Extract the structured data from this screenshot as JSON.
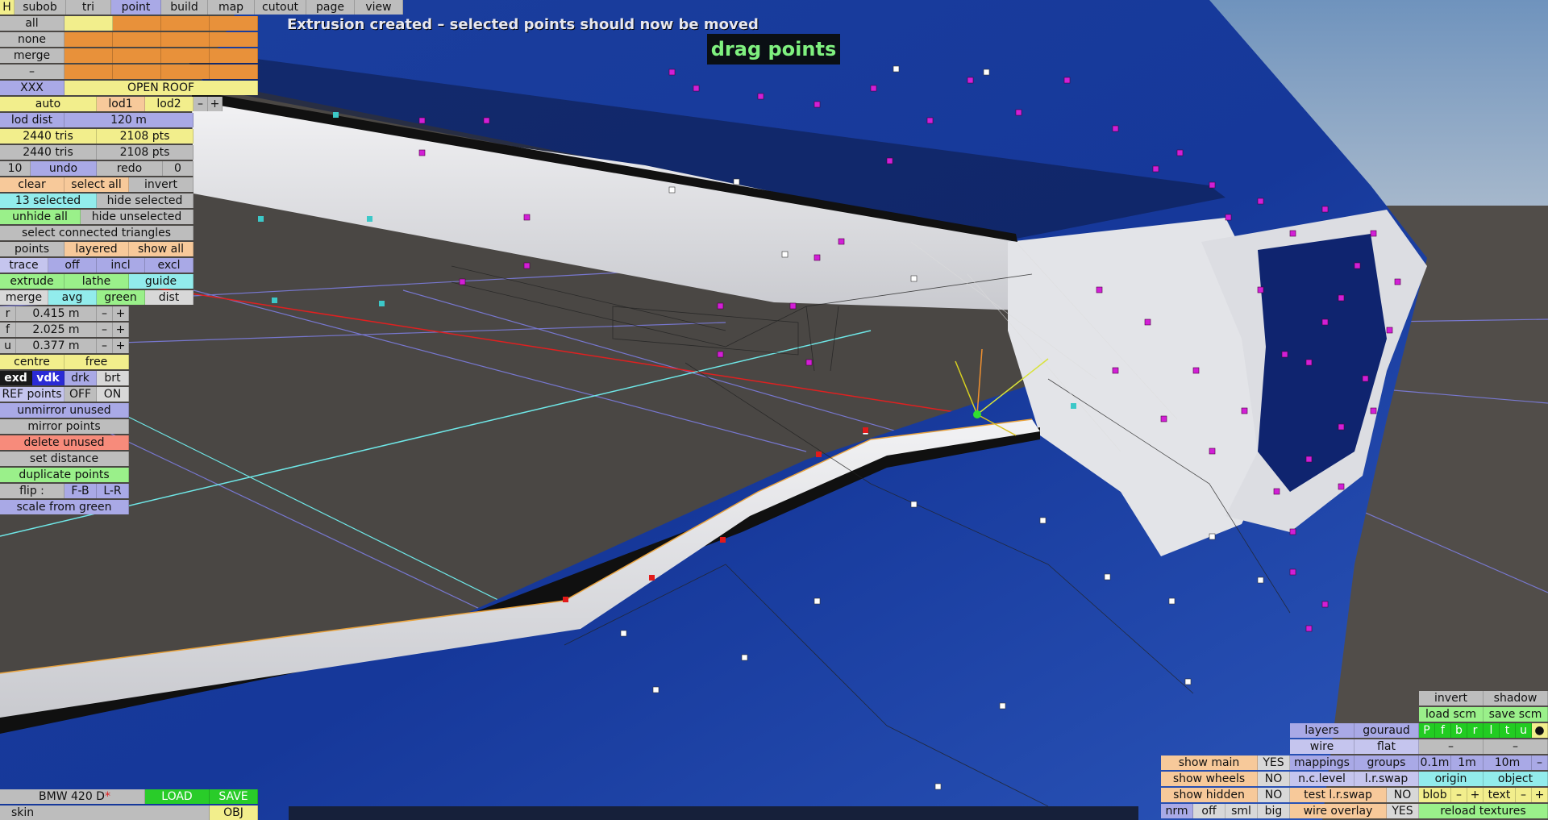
{
  "message": "Extrusion created – selected points should now be moved",
  "mode_label": "drag points",
  "colors": {
    "panel_gray": "#bdbdbd",
    "yellow": "#f2ee8c",
    "orange": "#e8913a",
    "blue": "#a9a9e6",
    "green": "#9af08a",
    "cyan": "#92ecec",
    "red": "#f78b7b",
    "car_paint": "#173e9c",
    "selected_point": "#d21fd6"
  },
  "menu": {
    "h": "H",
    "items": [
      "subob",
      "tri",
      "point",
      "build",
      "map",
      "cutout",
      "page",
      "view"
    ],
    "active": "point"
  },
  "groups": {
    "all": "all",
    "none": "none",
    "merge": "merge",
    "dash": "–",
    "xxx": "XXX",
    "open_roof": "OPEN ROOF"
  },
  "lod": {
    "auto": "auto",
    "lod1": "lod1",
    "lod2": "lod2",
    "minus": "–",
    "plus": "+",
    "dist_label": "lod dist",
    "dist_value": "120 m",
    "tris1": "2440 tris",
    "pts1": "2108 pts",
    "tris2": "2440 tris",
    "pts2": "2108 pts"
  },
  "history": {
    "undo_count": "10",
    "undo": "undo",
    "redo": "redo",
    "redo_count": "0"
  },
  "select": {
    "clear": "clear",
    "select_all": "select all",
    "invert": "invert",
    "selected": "13 selected",
    "hide_selected": "hide selected",
    "unhide_all": "unhide all",
    "hide_unselected": "hide unselected",
    "select_connected": "select connected triangles"
  },
  "points": {
    "points": "points",
    "layered": "layered",
    "show_all": "show all",
    "trace": "trace",
    "off": "off",
    "incl": "incl",
    "excl": "excl",
    "extrude": "extrude",
    "lathe": "lathe",
    "guide": "guide",
    "merge": "merge",
    "avg": "avg",
    "green": "green",
    "dist": "dist"
  },
  "params": [
    {
      "label": "r",
      "value": "0.415 m",
      "minus": "–",
      "plus": "+"
    },
    {
      "label": "f",
      "value": "2.025 m",
      "minus": "–",
      "plus": "+"
    },
    {
      "label": "u",
      "value": "0.377 m",
      "minus": "–",
      "plus": "+"
    }
  ],
  "tools": {
    "centre": "centre",
    "free": "free",
    "exd": "exd",
    "vdk": "vdk",
    "drk": "drk",
    "brt": "brt",
    "ref_points": "REF points",
    "ref_off": "OFF",
    "ref_on": "ON",
    "unmirror": "unmirror unused",
    "mirror": "mirror points",
    "delete_unused": "delete unused",
    "set_distance": "set distance",
    "duplicate": "duplicate points",
    "flip": "flip :",
    "fb": "F-B",
    "lr": "L-R",
    "scale_green": "scale from green"
  },
  "file": {
    "name": "BMW 420 D",
    "modified": "*",
    "load": "LOAD",
    "save": "SAVE",
    "skin": "skin",
    "obj": "OBJ"
  },
  "right": {
    "invert": "invert",
    "shadow": "shadow",
    "load_scm": "load scm",
    "save_scm": "save scm",
    "layers": "layers",
    "gouraud": "gouraud",
    "wire": "wire",
    "flat": "flat",
    "mappings": "mappings",
    "groups": "groups",
    "nclevel": "n.c.level",
    "lrswap": "l.r.swap",
    "test_lrswap": "test l.r.swap",
    "test_no": "NO",
    "wire_overlay": "wire overlay",
    "wire_yes": "YES",
    "letters": [
      "P",
      "f",
      "b",
      "r",
      "l",
      "t",
      "u",
      "●"
    ],
    "dash1": "–",
    "dash2": "–",
    "step1": "0.1m",
    "step2": "1m",
    "step3": "10m",
    "step_minus": "–",
    "origin": "origin",
    "object": "object",
    "blob": "blob",
    "bminus": "–",
    "bplus": "+",
    "text": "text",
    "tminus": "–",
    "tplus": "+",
    "reload": "reload textures",
    "show_main": "show main",
    "main_val": "YES",
    "show_wheels": "show wheels",
    "wheels_val": "NO",
    "show_hidden": "show hidden",
    "hidden_val": "NO",
    "nrm": "nrm",
    "off": "off",
    "sml": "sml",
    "big": "big"
  }
}
